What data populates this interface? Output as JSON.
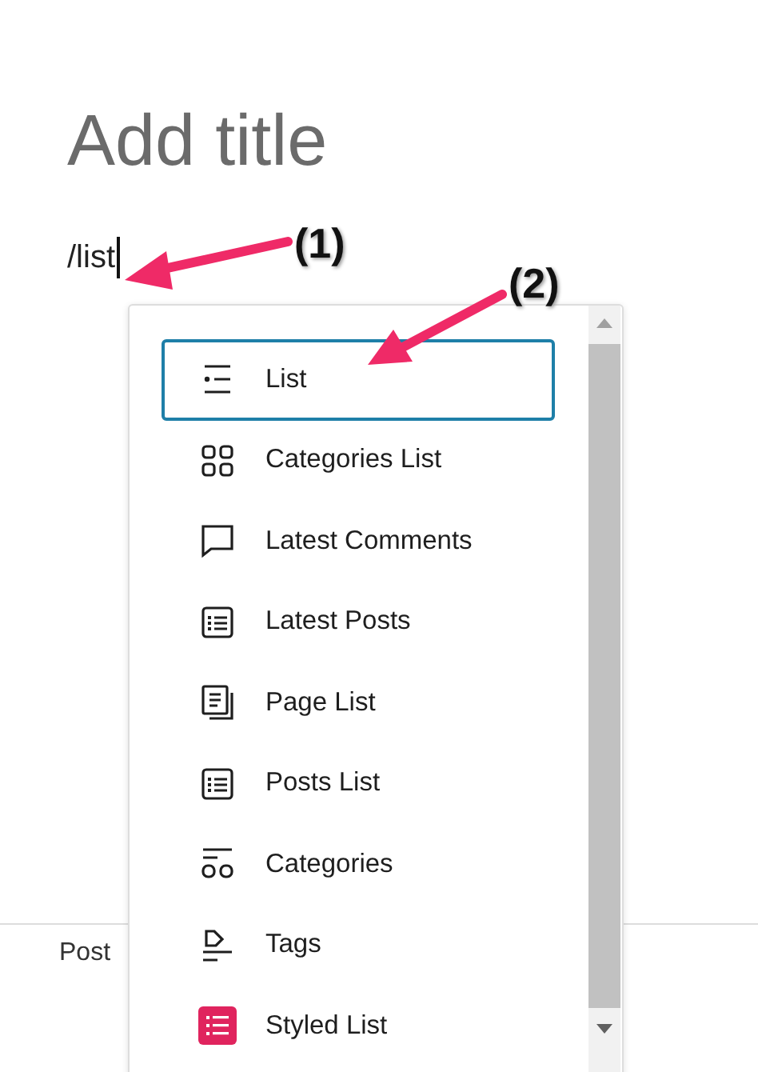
{
  "title_placeholder": "Add title",
  "typed_text": "/list",
  "inserter": {
    "items": [
      {
        "label": "List",
        "kind": "list",
        "selected": true
      },
      {
        "label": "Categories List",
        "kind": "grid",
        "selected": false
      },
      {
        "label": "Latest Comments",
        "kind": "comment",
        "selected": false
      },
      {
        "label": "Latest Posts",
        "kind": "posts",
        "selected": false
      },
      {
        "label": "Page List",
        "kind": "pages",
        "selected": false
      },
      {
        "label": "Posts List",
        "kind": "posts",
        "selected": false
      },
      {
        "label": "Categories",
        "kind": "categories",
        "selected": false
      },
      {
        "label": "Tags",
        "kind": "tag",
        "selected": false
      },
      {
        "label": "Styled List",
        "kind": "styled",
        "selected": false
      }
    ]
  },
  "annotations": [
    {
      "label": "(1)"
    },
    {
      "label": "(2)"
    }
  ],
  "status_bar": {
    "label": "Post"
  }
}
